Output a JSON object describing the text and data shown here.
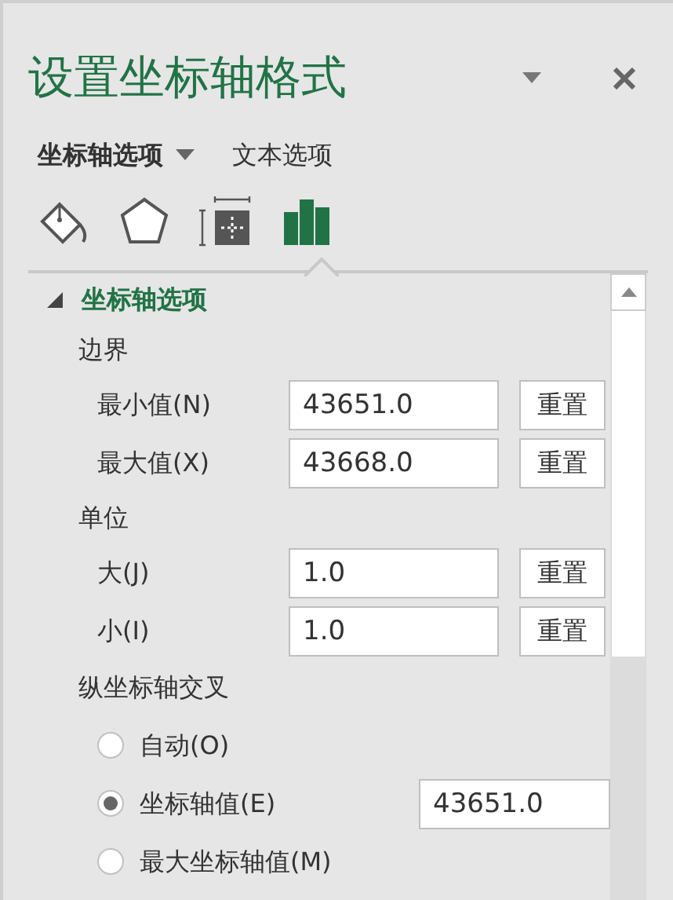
{
  "panel": {
    "title": "设置坐标轴格式"
  },
  "tabs": [
    {
      "label": "坐标轴选项",
      "selected": true
    },
    {
      "label": "文本选项",
      "selected": false
    }
  ],
  "icon_tabs": [
    {
      "kind": "fill",
      "selected": false
    },
    {
      "kind": "shape",
      "selected": false
    },
    {
      "kind": "size",
      "selected": false
    },
    {
      "kind": "chart",
      "selected": true
    }
  ],
  "section": {
    "title": "坐标轴选项",
    "expanded": true
  },
  "groups": [
    {
      "title": "边界",
      "rows": [
        {
          "label": "最小值(N)",
          "value": "43651.0",
          "button": "重置"
        },
        {
          "label": "最大值(X)",
          "value": "43668.0",
          "button": "重置"
        }
      ]
    },
    {
      "title": "单位",
      "rows": [
        {
          "label": "大(J)",
          "value": "1.0",
          "button": "重置"
        },
        {
          "label": "小(I)",
          "value": "1.0",
          "button": "重置"
        }
      ]
    }
  ],
  "crosses": {
    "title": "纵坐标轴交叉",
    "options": [
      {
        "label": "自动(O)",
        "selected": false
      },
      {
        "label": "坐标轴值(E)",
        "selected": true,
        "value": "43651.0"
      },
      {
        "label": "最大坐标轴值(M)",
        "selected": false
      }
    ]
  }
}
